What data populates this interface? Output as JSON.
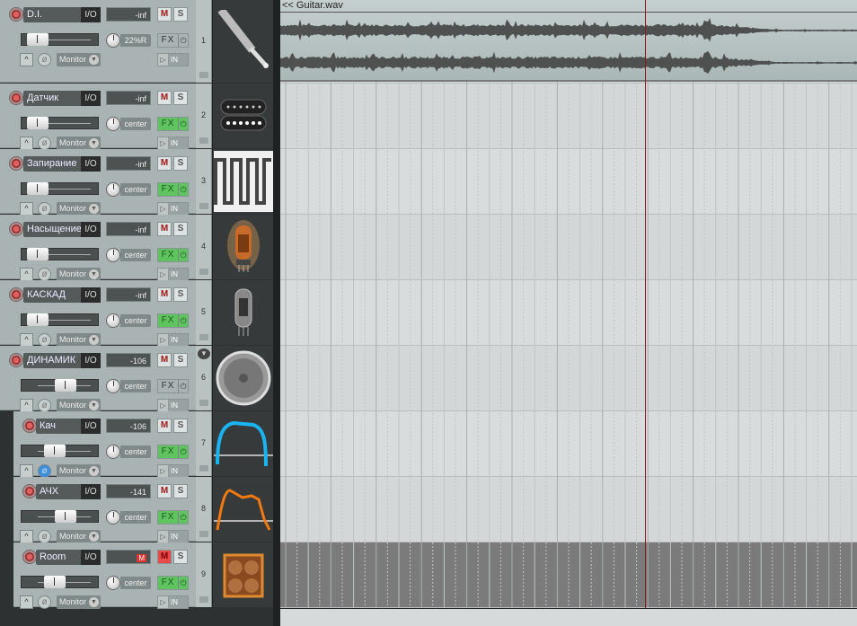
{
  "item": {
    "title": "<< Guitar.wav"
  },
  "tracks": [
    {
      "number": "1",
      "name": "D.I.",
      "io": "I/O",
      "meter": "-inf",
      "mute": "M",
      "solo": "S",
      "pan": "22%R",
      "fx": "FX",
      "fx_active": false,
      "monitor": "Monitor",
      "in": "IN",
      "env": "^",
      "phase": "ø",
      "fader_pos": 0.1,
      "icon": "guitar-jack-icon",
      "child": false,
      "muted": false,
      "phase_on": false
    },
    {
      "number": "2",
      "name": "Датчик",
      "io": "I/O",
      "meter": "-inf",
      "mute": "M",
      "solo": "S",
      "pan": "center",
      "fx": "FX",
      "fx_active": true,
      "monitor": "Monitor",
      "in": "IN",
      "env": "^",
      "phase": "ø",
      "fader_pos": 0.1,
      "icon": "humbucker-pickup-icon",
      "child": false,
      "muted": false,
      "phase_on": false
    },
    {
      "number": "3",
      "name": "Запирание",
      "io": "I/O",
      "meter": "-inf",
      "mute": "M",
      "solo": "S",
      "pan": "center",
      "fx": "FX",
      "fx_active": true,
      "monitor": "Monitor",
      "in": "IN",
      "env": "^",
      "phase": "ø",
      "fader_pos": 0.1,
      "icon": "square-wave-icon",
      "child": false,
      "muted": false,
      "phase_on": false
    },
    {
      "number": "4",
      "name": "Насыщение",
      "io": "I/O",
      "meter": "-inf",
      "mute": "M",
      "solo": "S",
      "pan": "center",
      "fx": "FX",
      "fx_active": true,
      "monitor": "Monitor",
      "in": "IN",
      "env": "^",
      "phase": "ø",
      "fader_pos": 0.1,
      "icon": "glowing-tube-icon",
      "child": false,
      "muted": false,
      "phase_on": false
    },
    {
      "number": "5",
      "name": "КАСКАД",
      "io": "I/O",
      "meter": "-inf",
      "mute": "M",
      "solo": "S",
      "pan": "center",
      "fx": "FX",
      "fx_active": true,
      "monitor": "Monitor",
      "in": "IN",
      "env": "^",
      "phase": "ø",
      "fader_pos": 0.1,
      "icon": "vacuum-tube-icon",
      "child": false,
      "muted": false,
      "phase_on": false
    },
    {
      "number": "6",
      "name": "ДИНАМИК",
      "io": "I/O",
      "meter": "-106",
      "mute": "M",
      "solo": "S",
      "pan": "center",
      "fx": "FX",
      "fx_active": false,
      "monitor": "Monitor",
      "in": "IN",
      "env": "^",
      "phase": "ø",
      "fader_pos": 0.6,
      "icon": "speaker-icon",
      "child": false,
      "folder": true,
      "muted": false,
      "phase_on": false
    },
    {
      "number": "7",
      "name": "Кач",
      "io": "I/O",
      "meter": "-106",
      "mute": "M",
      "solo": "S",
      "pan": "center",
      "fx": "FX",
      "fx_active": true,
      "monitor": "Monitor",
      "in": "IN",
      "env": "^",
      "phase": "ø",
      "fader_pos": 0.4,
      "icon": "bandpass-curve-blue-icon",
      "child": true,
      "muted": false,
      "phase_on": true
    },
    {
      "number": "8",
      "name": "АЧХ",
      "io": "I/O",
      "meter": "-141",
      "mute": "M",
      "solo": "S",
      "pan": "center",
      "fx": "FX",
      "fx_active": true,
      "monitor": "Monitor",
      "in": "IN",
      "env": "^",
      "phase": "ø",
      "fader_pos": 0.6,
      "icon": "frequency-response-orange-icon",
      "child": true,
      "muted": false,
      "phase_on": false
    },
    {
      "number": "9",
      "name": "Room",
      "io": "I/O",
      "meter": "M",
      "mute": "M",
      "solo": "S",
      "pan": "center",
      "fx": "FX",
      "fx_active": true,
      "monitor": "Monitor",
      "in": "IN",
      "env": "^",
      "phase": "ø",
      "fader_pos": 0.4,
      "icon": "guitar-cabinet-icon",
      "child": true,
      "muted": true,
      "phase_on": false
    }
  ],
  "colors": {
    "fx_active": "#5fc35f",
    "mute_on": "#e84a4a",
    "playhead": "#8b1a1a",
    "panel": "#a9b3b3"
  }
}
